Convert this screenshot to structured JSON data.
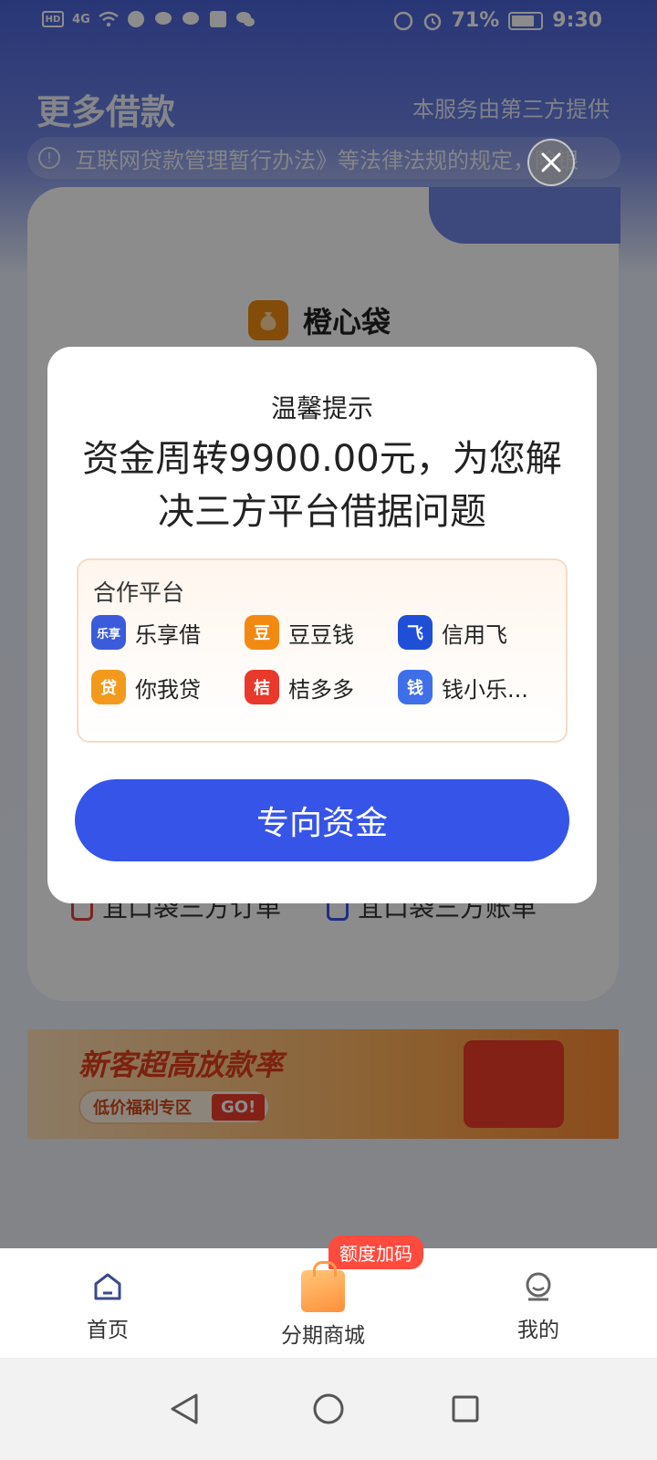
{
  "status_bar": {
    "battery": "71%",
    "time": "9:30",
    "network": "4G",
    "hd": "HD"
  },
  "header": {
    "title": "更多借款",
    "note": "本服务由第三方提供",
    "notice": "互联网贷款管理暂行办法》等法律法规的规定，除银"
  },
  "card": {
    "brand_name": "橙心袋",
    "orders": [
      {
        "label": "宜口袋三方订单"
      },
      {
        "label": "宜口袋三方账单"
      }
    ]
  },
  "banner": {
    "title": "新客超高放款率",
    "pill": "低价福利专区",
    "go": "GO!"
  },
  "dialog": {
    "title": "温馨提示",
    "message": "资金周转9900.00元，为您解决三方平台借据问题",
    "partners_label": "合作平台",
    "partners": [
      {
        "name": "乐享借",
        "logo": "乐享",
        "color": "#3b5bdb"
      },
      {
        "name": "豆豆钱",
        "logo": "豆",
        "color": "#f28a12"
      },
      {
        "name": "信用飞",
        "logo": "飞",
        "color": "#1f4fd6"
      },
      {
        "name": "你我贷",
        "logo": "贷",
        "color": "#f39a1c"
      },
      {
        "name": "桔多多",
        "logo": "桔",
        "color": "#e8392b"
      },
      {
        "name": "钱小乐...",
        "logo": "钱",
        "color": "#3f6fe8"
      }
    ],
    "cta": "专向资金"
  },
  "bottom_nav": {
    "promo_badge": "额度加码",
    "items": [
      {
        "label": "首页",
        "icon": "home-icon"
      },
      {
        "label": "分期商城",
        "icon": "shopping-bag-icon"
      },
      {
        "label": "我的",
        "icon": "profile-icon"
      }
    ]
  },
  "colors": {
    "primary": "#3654e8",
    "overlay": "rgba(0,0,0,0.45)",
    "header_bg": "#4b63d8"
  }
}
